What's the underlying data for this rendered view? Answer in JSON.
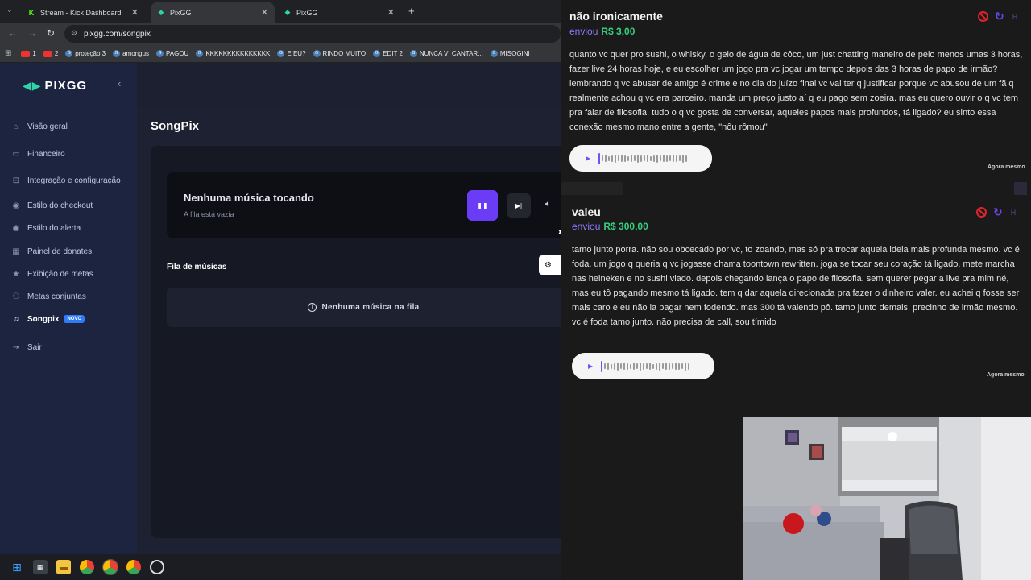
{
  "browser": {
    "tabs": [
      {
        "label": "Stream - Kick Dashboard",
        "icon": "kick-icon"
      },
      {
        "label": "PixGG",
        "icon": "pixgg-icon"
      },
      {
        "label": "PixGG",
        "icon": "pixgg-icon"
      }
    ],
    "url": "pixgg.com/songpix",
    "bookmarks": [
      {
        "label": "1",
        "icon": "youtube-icon"
      },
      {
        "label": "2",
        "icon": "youtube-icon"
      },
      {
        "label": "proteção 3",
        "icon": "pixgg-icon"
      },
      {
        "label": "amongus",
        "icon": "pixgg-icon"
      },
      {
        "label": "PAGOU",
        "icon": "pixgg-icon"
      },
      {
        "label": "KKKKKKKKKKKKKKK",
        "icon": "pixgg-icon"
      },
      {
        "label": "E EU?",
        "icon": "pixgg-icon"
      },
      {
        "label": "RINDO MUITO",
        "icon": "pixgg-icon"
      },
      {
        "label": "EDIT 2",
        "icon": "pixgg-icon"
      },
      {
        "label": "NUNCA VI CANTAR...",
        "icon": "pixgg-icon"
      },
      {
        "label": "MISOGINI",
        "icon": "pixgg-icon"
      }
    ]
  },
  "app": {
    "logo": "PIXGG",
    "nav": [
      {
        "label": "Visão geral",
        "icon": "home-icon"
      },
      {
        "label": "Financeiro",
        "icon": "wallet-icon"
      },
      {
        "label": "Integração e configuração",
        "icon": "plug-icon"
      },
      {
        "label": "Estilo do checkout",
        "icon": "palette-icon"
      },
      {
        "label": "Estilo do alerta",
        "icon": "bell-icon"
      },
      {
        "label": "Painel de donates",
        "icon": "dashboard-icon"
      },
      {
        "label": "Exibição de metas",
        "icon": "star-icon"
      },
      {
        "label": "Metas conjuntas",
        "icon": "users-icon"
      },
      {
        "label": "Songpix",
        "icon": "music-icon",
        "badge": "NOVO"
      },
      {
        "label": "Sair",
        "icon": "logout-icon"
      }
    ],
    "page_title": "SongPix",
    "player": {
      "title": "Nenhuma música tocando",
      "subtitle": "A fila está vazia"
    },
    "queue": {
      "label": "Fila de músicas",
      "empty_text": "Nenhuma música na fila"
    }
  },
  "donations": [
    {
      "donor": "não ironicamente",
      "sent_label": "enviou",
      "amount": "R$ 3,00",
      "message": "quanto vc quer pro sushi, o whisky, o gelo de água de côco, um just chatting maneiro de pelo menos umas 3 horas, fazer live 24 horas hoje, e eu escolher um jogo pra vc jogar um tempo depois das 3 horas de papo de irmão? lembrando q vc abusar de amigo é crime e no dia do juízo final vc vai ter q justificar porque vc abusou de um fã q realmente achou q vc era parceiro. manda um preço justo aí q eu pago sem zoeira. mas eu quero ouvir o q vc tem pra falar de filosofia, tudo o q vc gosta de conversar, aqueles papos mais profundos, tá ligado? eu sinto essa conexão mesmo mano entre a gente, \"nôu rômou\"",
      "time": "Agora mesmo"
    },
    {
      "donor": "valeu",
      "sent_label": "enviou",
      "amount": "R$ 300,00",
      "message": "tamo junto porra. não sou obcecado por vc, to zoando, mas só pra trocar aquela ideia mais profunda mesmo. vc é foda. um jogo q queria q vc jogasse chama toontown rewritten. joga se tocar seu coração tá ligado. mete marcha nas heineken e no sushi viado. depois chegando lança o papo de filosofia. sem querer pegar a live pra mim né, mas eu tô pagando mesmo tá ligado. tem q dar aquela direcionada pra fazer o dinheiro valer. eu achei q fosse ser mais caro e eu não ia pagar nem fodendo. mas 300 tá valendo pô. tamo junto demais. precinho de irmão mesmo. vc é foda tamo junto. não precisa de call, sou tímido",
      "time": "Agora mesmo"
    }
  ],
  "colors": {
    "accent_purple": "#6b3cf6",
    "money_green": "#35d07f",
    "pixgg_teal": "#2ed3a8",
    "ban_red": "#e0242d"
  }
}
